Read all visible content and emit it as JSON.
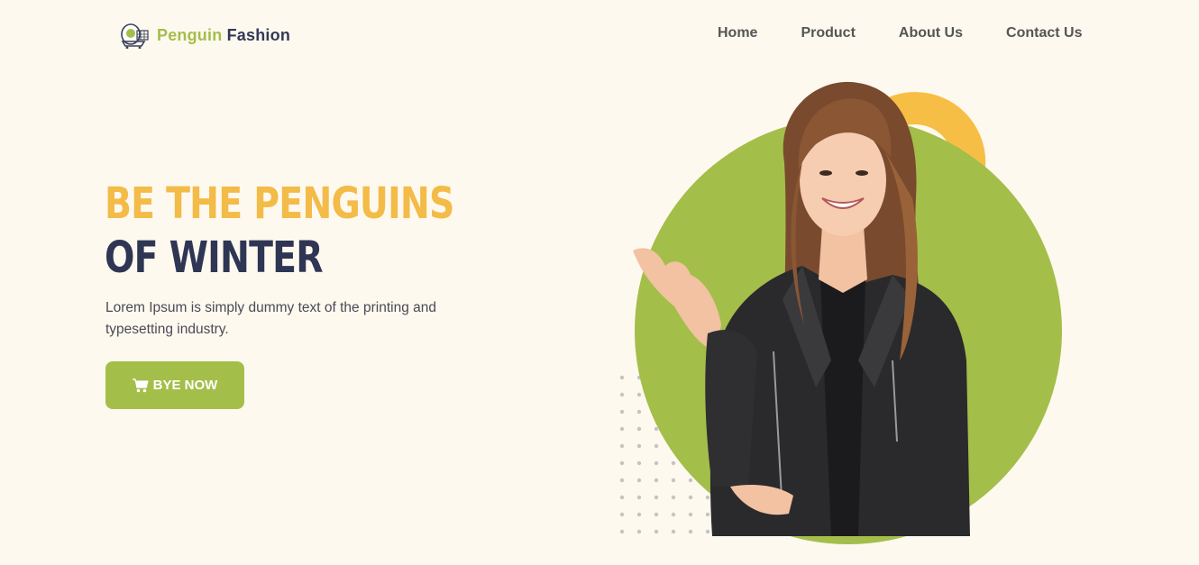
{
  "header": {
    "logo": {
      "icon": "penguin-cart-icon",
      "word1": "Penguin",
      "word2": "Fashion"
    },
    "nav": [
      {
        "label": "Home"
      },
      {
        "label": "Product"
      },
      {
        "label": "About Us"
      },
      {
        "label": "Contact Us"
      }
    ]
  },
  "hero": {
    "headline_line1": "BE THE PENGUINS",
    "headline_line2": "OF WINTER",
    "description": "Lorem Ipsum is simply dummy text of the printing and typesetting industry.",
    "cta": {
      "icon": "shopping-cart-icon",
      "label": "BYE NOW"
    },
    "image": {
      "subject": "smiling-woman-in-black-leather-jacket"
    }
  },
  "colors": {
    "background": "#fef9ef",
    "accent_green": "#a4be4a",
    "accent_yellow": "#f3bb47",
    "navy": "#2f3654",
    "nav_text": "#555555"
  }
}
